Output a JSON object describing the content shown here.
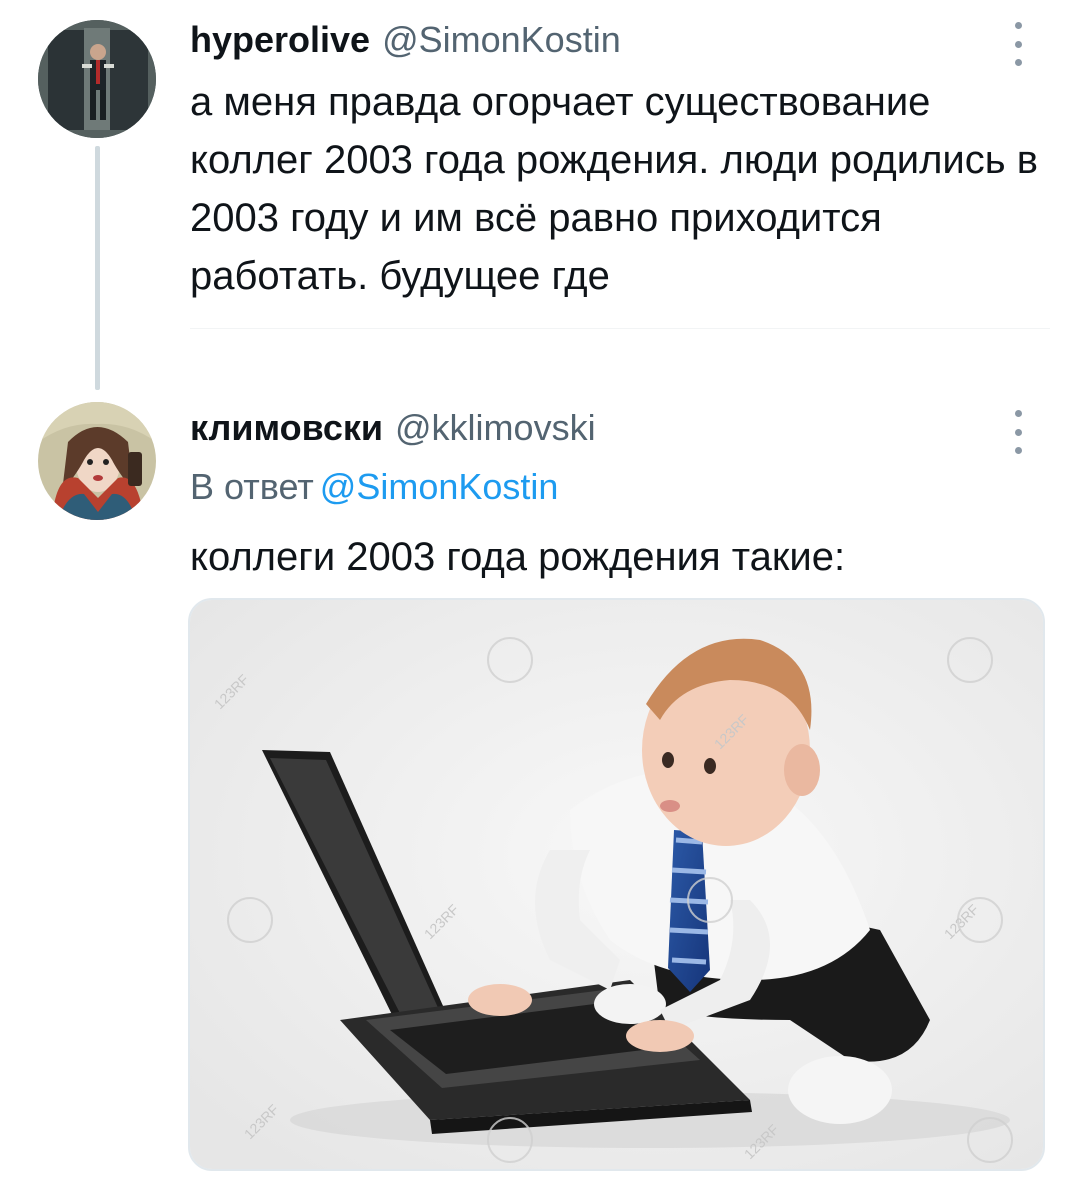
{
  "thread": {
    "tweets": [
      {
        "display_name": "hyperolive",
        "handle": "@SimonKostin",
        "text": "а меня правда огорчает существование коллег 2003 года рождения. люди родились в 2003 году и им всё равно приходится работать. будущее где",
        "avatar": "avatar-photo-man-in-doorway"
      },
      {
        "display_name": "климовски",
        "handle": "@kklimovski",
        "reply_prefix": "В ответ",
        "reply_mention": "@SimonKostin",
        "text": "коллеги 2003 года рождения такие:",
        "avatar": "avatar-photo-woman-in-headscarf",
        "media": {
          "description_icon": "baby-laptop-photo",
          "watermark": "123RF"
        }
      }
    ]
  },
  "colors": {
    "text_primary": "#0f1419",
    "text_secondary": "#536471",
    "accent": "#1d9bf0",
    "thread_line": "#cfd9de"
  }
}
